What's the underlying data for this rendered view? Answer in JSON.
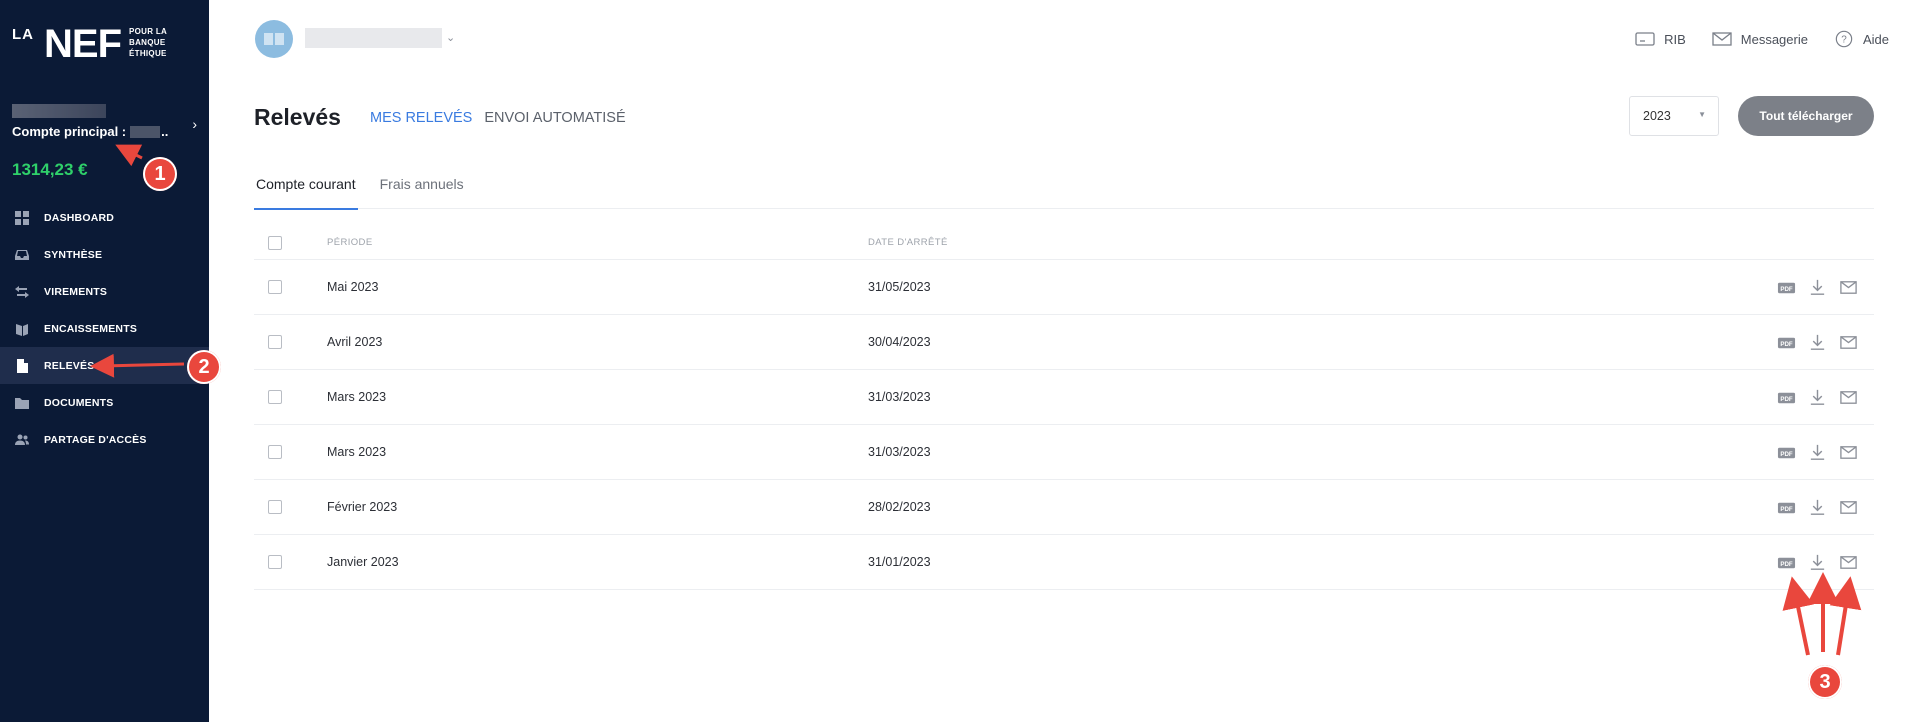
{
  "sidebar": {
    "logo": {
      "la": "LA",
      "nef": "NEF",
      "tagline": [
        "POUR LA",
        "BANQUE",
        "ÉTHIQUE"
      ]
    },
    "account": {
      "label": "Compte principal :",
      "ellipsis": "..",
      "balance": "1314,23 €"
    },
    "items": [
      {
        "label": "DASHBOARD",
        "icon": "dashboard-icon"
      },
      {
        "label": "SYNTHÈSE",
        "icon": "inbox-icon"
      },
      {
        "label": "VIREMENTS",
        "icon": "transfer-icon"
      },
      {
        "label": "ENCAISSEMENTS",
        "icon": "cheque-icon"
      },
      {
        "label": "RELEVÉS",
        "icon": "document-icon",
        "active": true
      },
      {
        "label": "DOCUMENTS",
        "icon": "folder-icon"
      },
      {
        "label": "PARTAGE D'ACCÈS",
        "icon": "users-icon"
      }
    ]
  },
  "topbar": {
    "links": [
      {
        "label": "RIB",
        "icon": "card-icon"
      },
      {
        "label": "Messagerie",
        "icon": "mail-icon"
      },
      {
        "label": "Aide",
        "icon": "help-icon"
      }
    ]
  },
  "header": {
    "title": "Relevés",
    "subnav": {
      "active": "MES RELEVÉS",
      "inactive": "ENVOI AUTOMATISÉ"
    },
    "year": "2023",
    "download_all": "Tout télécharger"
  },
  "tabs": [
    "Compte courant",
    "Frais annuels"
  ],
  "table": {
    "headers": {
      "period": "PÉRIODE",
      "date": "DATE D'ARRÊTÉ"
    },
    "rows": [
      {
        "period": "Mai 2023",
        "date": "31/05/2023"
      },
      {
        "period": "Avril 2023",
        "date": "30/04/2023"
      },
      {
        "period": "Mars 2023",
        "date": "31/03/2023"
      },
      {
        "period": "Mars 2023",
        "date": "31/03/2023"
      },
      {
        "period": "Février 2023",
        "date": "28/02/2023"
      },
      {
        "period": "Janvier 2023",
        "date": "31/01/2023"
      }
    ],
    "pdf_label": "PDF"
  },
  "annotations": [
    "1",
    "2",
    "3"
  ],
  "colors": {
    "sidebar": "#0b1a36",
    "accent": "#3a7be0",
    "balance": "#2fd06a",
    "annotation": "#e9473d"
  }
}
